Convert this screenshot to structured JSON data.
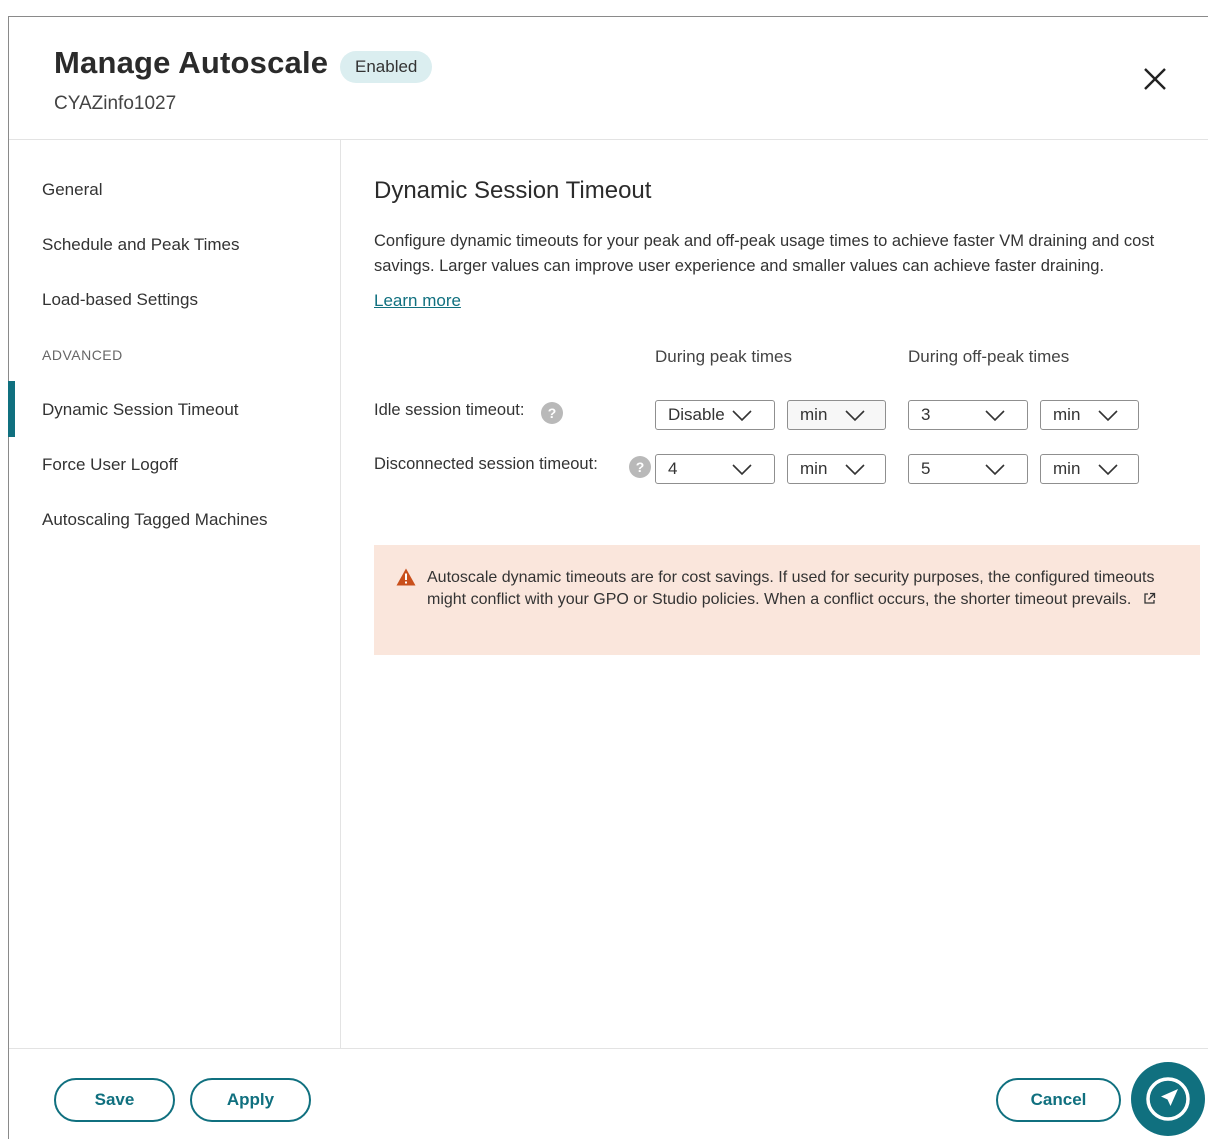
{
  "dialog": {
    "title": "Manage Autoscale",
    "status_badge": "Enabled",
    "subtitle": "CYAZinfo1027"
  },
  "sidebar": {
    "items": [
      {
        "label": "General"
      },
      {
        "label": "Schedule and Peak Times"
      },
      {
        "label": "Load-based Settings"
      },
      {
        "label": "Dynamic Session Timeout",
        "active": true
      },
      {
        "label": "Force User Logoff"
      },
      {
        "label": "Autoscaling Tagged Machines"
      }
    ],
    "section_label": "ADVANCED"
  },
  "main": {
    "heading": "Dynamic Session Timeout",
    "description": "Configure dynamic timeouts for your peak and off-peak usage times to achieve faster VM draining and cost savings. Larger values can improve user experience and smaller values can achieve faster draining.",
    "learn_more": "Learn more",
    "columns": {
      "peak": "During peak times",
      "offpeak": "During off-peak times"
    },
    "idle": {
      "label": "Idle session timeout:",
      "peak_value": "Disable",
      "peak_unit": "min",
      "offpeak_value": "3",
      "offpeak_unit": "min"
    },
    "disconnected": {
      "label": "Disconnected session timeout:",
      "peak_value": "4",
      "peak_unit": "min",
      "offpeak_value": "5",
      "offpeak_unit": "min"
    },
    "help_glyph": "?",
    "warning": {
      "text": "Autoscale dynamic timeouts are for cost savings. If used for security purposes, the configured timeouts might conflict with your GPO or Studio policies. When a conflict occurs, the shorter timeout prevails."
    }
  },
  "footer": {
    "save": "Save",
    "apply": "Apply",
    "cancel": "Cancel"
  },
  "colors": {
    "accent": "#10707f",
    "badge_bg": "#dbeef0",
    "warning_bg": "#fae6dc",
    "warning_icon": "#c9501c"
  },
  "icons": [
    "close-icon",
    "help-icon",
    "chevron-down-icon",
    "warning-icon",
    "external-link-icon",
    "navigate-icon"
  ]
}
